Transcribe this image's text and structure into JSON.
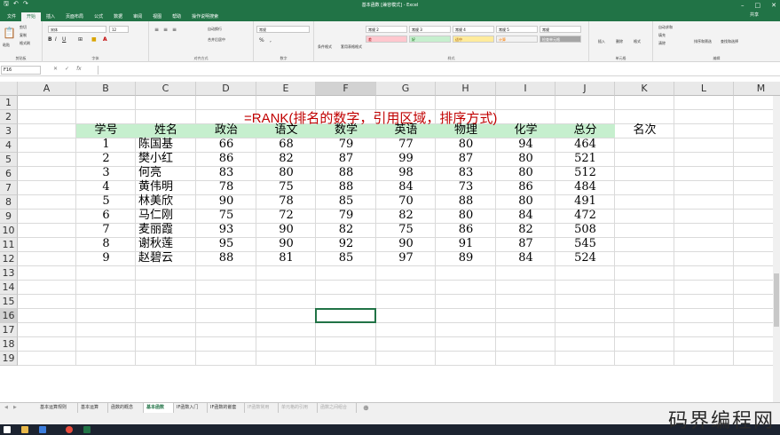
{
  "window": {
    "title": "基本函数 [兼容模式] - Excel"
  },
  "quick_access": [
    "save-icon",
    "undo-icon",
    "redo-icon"
  ],
  "menu_tabs": [
    {
      "label": "文件",
      "active": false
    },
    {
      "label": "开始",
      "active": true
    },
    {
      "label": "插入",
      "active": false
    },
    {
      "label": "页面布局",
      "active": false
    },
    {
      "label": "公式",
      "active": false
    },
    {
      "label": "数据",
      "active": false
    },
    {
      "label": "审阅",
      "active": false
    },
    {
      "label": "视图",
      "active": false
    },
    {
      "label": "帮助",
      "active": false
    },
    {
      "label": "操作说明搜索",
      "active": false
    }
  ],
  "share_label": "共享",
  "ribbon": {
    "clipboard": {
      "label": "剪贴板",
      "paste": "粘贴",
      "cut": "剪切",
      "copy": "复制",
      "format_painter": "格式刷"
    },
    "font": {
      "label": "字体",
      "font_name": "宋体",
      "font_size": "12"
    },
    "alignment": {
      "label": "对齐方式",
      "wrap": "自动换行",
      "merge": "合并后居中"
    },
    "number": {
      "label": "数字",
      "format": "常规"
    },
    "styles": {
      "label": "样式",
      "conditional": "条件格式",
      "table_format": "套用表格格式",
      "cells": [
        {
          "name": "常规 2",
          "bg": "#ffffff",
          "color": "#000000"
        },
        {
          "name": "常规 3",
          "bg": "#ffffff",
          "color": "#000000"
        },
        {
          "name": "常规 4",
          "bg": "#ffffff",
          "color": "#000000"
        },
        {
          "name": "常规 5",
          "bg": "#ffffff",
          "color": "#000000"
        },
        {
          "name": "常规",
          "bg": "#ffffff",
          "color": "#000000"
        },
        {
          "name": "差",
          "bg": "#ffc7ce",
          "color": "#9c0006"
        },
        {
          "name": "好",
          "bg": "#c6efce",
          "color": "#006100"
        },
        {
          "name": "适中",
          "bg": "#ffeb9c",
          "color": "#9c5700"
        },
        {
          "name": "计算",
          "bg": "#f2f2f2",
          "color": "#fa7d00"
        },
        {
          "name": "检查单元格",
          "bg": "#a5a5a5",
          "color": "#ffffff"
        }
      ]
    },
    "cells_group": {
      "label": "单元格",
      "insert": "插入",
      "delete": "删除",
      "format": "格式"
    },
    "editing": {
      "label": "编辑",
      "autosum": "自动求和",
      "fill": "填充",
      "clear": "清除",
      "sort": "排序和筛选",
      "find": "查找和选择"
    }
  },
  "name_box": "F16",
  "columns": [
    "A",
    "B",
    "C",
    "D",
    "E",
    "F",
    "G",
    "H",
    "I",
    "J",
    "K",
    "L",
    "M"
  ],
  "selected_column": "F",
  "rows": [
    "1",
    "2",
    "3",
    "4",
    "5",
    "6",
    "7",
    "8",
    "9",
    "10",
    "11",
    "12",
    "13",
    "14",
    "15",
    "16",
    "17",
    "18",
    "19"
  ],
  "selected_row": "16",
  "formula_note": "=RANK(排名的数字，引用区域，排序方式)",
  "table": {
    "headers": [
      "学号",
      "姓名",
      "政治",
      "语文",
      "数学",
      "英语",
      "物理",
      "化学",
      "总分",
      "名次"
    ],
    "header_bg": "#c6efce",
    "records": [
      [
        "1",
        "陈国基",
        "66",
        "68",
        "79",
        "77",
        "80",
        "94",
        "464",
        ""
      ],
      [
        "2",
        "樊小红",
        "86",
        "82",
        "87",
        "99",
        "87",
        "80",
        "521",
        ""
      ],
      [
        "3",
        "何亮",
        "83",
        "80",
        "88",
        "98",
        "83",
        "80",
        "512",
        ""
      ],
      [
        "4",
        "黄伟明",
        "78",
        "75",
        "88",
        "84",
        "73",
        "86",
        "484",
        ""
      ],
      [
        "5",
        "林美欣",
        "90",
        "78",
        "85",
        "70",
        "88",
        "80",
        "491",
        ""
      ],
      [
        "6",
        "马仁刚",
        "75",
        "72",
        "79",
        "82",
        "80",
        "84",
        "472",
        ""
      ],
      [
        "7",
        "麦丽霞",
        "93",
        "90",
        "82",
        "75",
        "86",
        "82",
        "508",
        ""
      ],
      [
        "8",
        "谢秋莲",
        "95",
        "90",
        "92",
        "90",
        "91",
        "87",
        "545",
        ""
      ],
      [
        "9",
        "赵碧云",
        "88",
        "81",
        "85",
        "97",
        "89",
        "84",
        "524",
        ""
      ]
    ]
  },
  "sheet_tabs": [
    {
      "label": "基本运算规则",
      "state": "normal"
    },
    {
      "label": "基本运算",
      "state": "normal"
    },
    {
      "label": "函数的概念",
      "state": "normal"
    },
    {
      "label": "基本函数",
      "state": "active"
    },
    {
      "label": "IF函数入门",
      "state": "normal"
    },
    {
      "label": "IF函数的嵌套",
      "state": "normal"
    },
    {
      "label": "IF函数常用",
      "state": "dim"
    },
    {
      "label": "单元格的引用",
      "state": "dim"
    },
    {
      "label": "函数之间组合",
      "state": "dim"
    }
  ],
  "watermark": "码界编程网",
  "theme": {
    "accent": "#217346"
  }
}
